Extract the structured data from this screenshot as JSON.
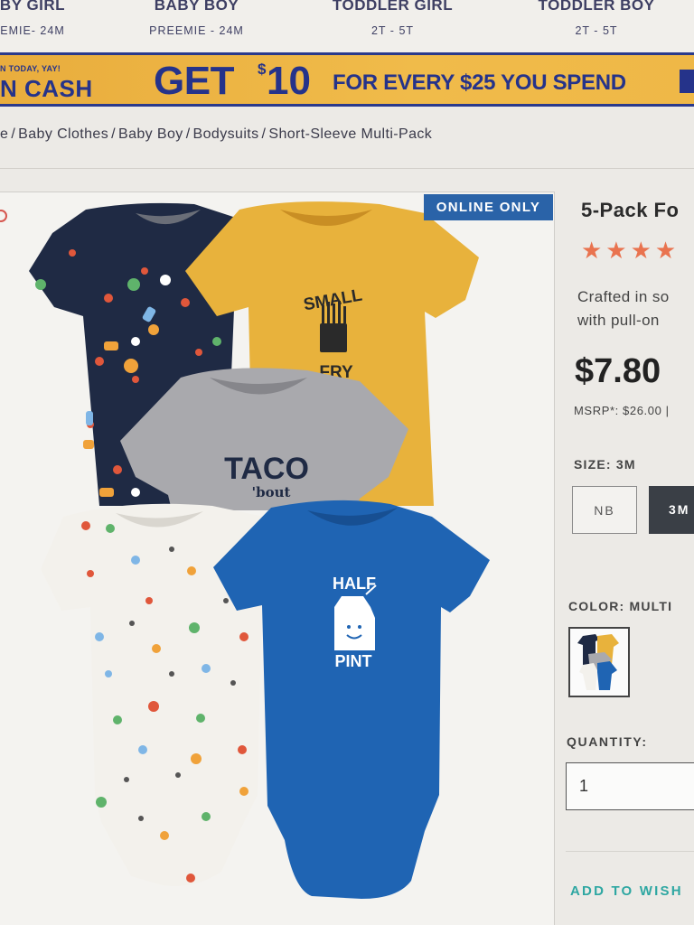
{
  "nav": {
    "items": [
      {
        "title": "BY GIRL",
        "sub": "EMIE- 24M"
      },
      {
        "title": "BABY BOY",
        "sub": "PREEMIE - 24M"
      },
      {
        "title": "TODDLER GIRL",
        "sub": "2T - 5T"
      },
      {
        "title": "TODDLER BOY",
        "sub": "2T - 5T"
      }
    ]
  },
  "promo": {
    "left_small": "N TODAY, YAY!",
    "left_big": "N CASH",
    "get": "GET",
    "dollar": "$",
    "amount": "10",
    "tail": "FOR EVERY $25 YOU SPEND"
  },
  "breadcrumb": [
    "e",
    "Baby Clothes",
    "Baby Boy",
    "Bodysuits",
    "Short-Sleeve Multi-Pack"
  ],
  "badge": "ONLINE ONLY",
  "bodysuits": {
    "small_fry_1": "SMALL",
    "small_fry_2": "FRY",
    "taco_1": "TACO",
    "taco_2": "'bout",
    "half_pint_1": "HALF",
    "half_pint_2": "PINT"
  },
  "product": {
    "title": "5-Pack Fo",
    "stars": "★★★★",
    "desc_line1": "Crafted in so",
    "desc_line2": "with pull-on",
    "price": "$7.80",
    "msrp": "MSRP*: $26.00 |"
  },
  "size": {
    "label": "SIZE: 3M",
    "options": [
      "NB",
      "3M"
    ],
    "selected": "3M"
  },
  "color": {
    "label": "COLOR: MULTI"
  },
  "quantity": {
    "label": "QUANTITY:",
    "value": "1"
  },
  "wishlist": "ADD TO WISH",
  "colors": {
    "navy": "#1f2a44",
    "mustard": "#e8b23c",
    "grey": "#a9a9ad",
    "white": "#f3f1ec",
    "blue": "#1f64b3",
    "accent": "#2a63a8",
    "star": "#e9734f",
    "teal": "#2ea7a2"
  }
}
